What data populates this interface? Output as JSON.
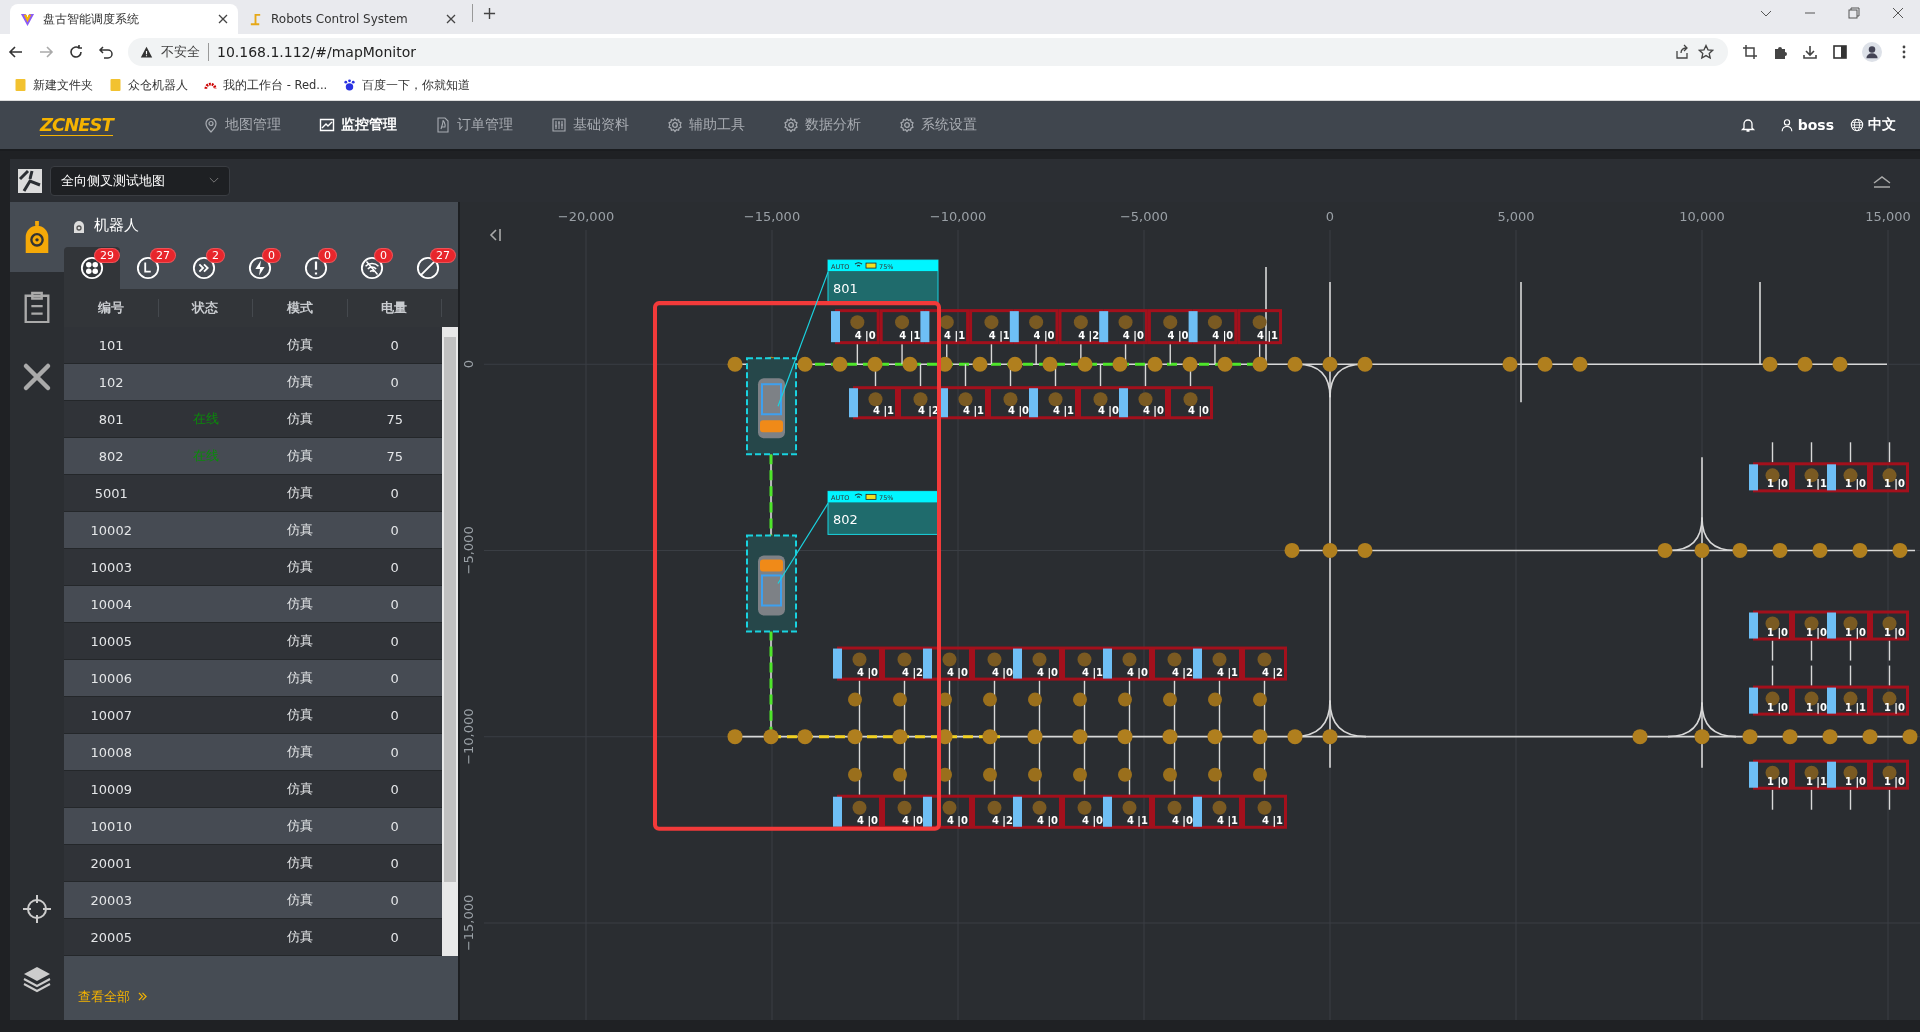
{
  "browser": {
    "tabs": [
      {
        "title": "盘古智能调度系统",
        "selected": true
      },
      {
        "title": "Robots Control System",
        "selected": false
      }
    ],
    "address": {
      "security": "不安全",
      "url": "10.168.1.112/#/mapMonitor"
    },
    "bookmarks": [
      "新建文件夹",
      "众仓机器人",
      "我的工作台 - Red...",
      "百度一下，你就知道"
    ]
  },
  "nav": {
    "logo": "ZCNEST",
    "items": [
      {
        "label": "地图管理",
        "selected": false
      },
      {
        "label": "监控管理",
        "selected": true
      },
      {
        "label": "订单管理",
        "selected": false
      },
      {
        "label": "基础资料",
        "selected": false
      },
      {
        "label": "辅助工具",
        "selected": false
      },
      {
        "label": "数据分析",
        "selected": false
      },
      {
        "label": "系统设置",
        "selected": false
      }
    ],
    "user": "boss",
    "language": "中文"
  },
  "map_selector": {
    "value": "全向侧叉测试地图"
  },
  "robot_panel": {
    "title": "机器人",
    "filters": [
      {
        "badge": "29",
        "selected": true
      },
      {
        "badge": "27",
        "selected": false
      },
      {
        "badge": "2",
        "selected": false
      },
      {
        "badge": "0",
        "selected": false
      },
      {
        "badge": "0",
        "selected": false
      },
      {
        "badge": "0",
        "selected": false
      },
      {
        "badge": "27",
        "selected": false
      }
    ],
    "columns": [
      "编号",
      "状态",
      "模式",
      "电量"
    ],
    "rows": [
      {
        "id": "101",
        "status": "",
        "mode": "仿真",
        "battery": "0"
      },
      {
        "id": "102",
        "status": "",
        "mode": "仿真",
        "battery": "0"
      },
      {
        "id": "801",
        "status": "在线",
        "mode": "仿真",
        "battery": "75"
      },
      {
        "id": "802",
        "status": "在线",
        "mode": "仿真",
        "battery": "75"
      },
      {
        "id": "5001",
        "status": "",
        "mode": "仿真",
        "battery": "0"
      },
      {
        "id": "10002",
        "status": "",
        "mode": "仿真",
        "battery": "0"
      },
      {
        "id": "10003",
        "status": "",
        "mode": "仿真",
        "battery": "0"
      },
      {
        "id": "10004",
        "status": "",
        "mode": "仿真",
        "battery": "0"
      },
      {
        "id": "10005",
        "status": "",
        "mode": "仿真",
        "battery": "0"
      },
      {
        "id": "10006",
        "status": "",
        "mode": "仿真",
        "battery": "0"
      },
      {
        "id": "10007",
        "status": "",
        "mode": "仿真",
        "battery": "0"
      },
      {
        "id": "10008",
        "status": "",
        "mode": "仿真",
        "battery": "0"
      },
      {
        "id": "10009",
        "status": "",
        "mode": "仿真",
        "battery": "0"
      },
      {
        "id": "10010",
        "status": "",
        "mode": "仿真",
        "battery": "0"
      },
      {
        "id": "20001",
        "status": "",
        "mode": "仿真",
        "battery": "0"
      },
      {
        "id": "20003",
        "status": "",
        "mode": "仿真",
        "battery": "0"
      },
      {
        "id": "20005",
        "status": "",
        "mode": "仿真",
        "battery": "0"
      }
    ],
    "view_all": "查看全部"
  },
  "map": {
    "x_ticks": [
      "−20,000",
      "−15,000",
      "−10,000",
      "−5,000",
      "0",
      "5,000",
      "10,000",
      "15,000"
    ],
    "y_ticks": [
      "0",
      "−5,000",
      "−10,000",
      "−15,000"
    ],
    "slot_rows": [
      {
        "labels": [
          "4 |0",
          "4 |1",
          "4 |1",
          "4 |1",
          "4 |0",
          "4 |2",
          "4 |0",
          "4 |0",
          "4 |0",
          "4 |1"
        ]
      },
      {
        "labels": [
          "4 |1",
          "4 |2",
          "4 |1",
          "4 |0",
          "4 |1",
          "4 |0",
          "4 |0",
          "4 |0"
        ]
      },
      {
        "labels": [
          "4 |0",
          "4 |2",
          "4 |0",
          "4 |0",
          "4 |0",
          "4 |1",
          "4 |0",
          "4 |2",
          "4 |1",
          "4 |2"
        ]
      },
      {
        "labels": [
          "4 |0",
          "4 |0",
          "4 |0",
          "4 |2",
          "4 |0",
          "4 |0",
          "4 |1",
          "4 |0",
          "4 |1",
          "4 |1"
        ]
      },
      {
        "labels": [
          "1 |0",
          "1 |1",
          "1 |0",
          "1 |0"
        ]
      },
      {
        "labels": [
          "1 |0",
          "1 |0",
          "1 |0",
          "1 |0"
        ]
      },
      {
        "labels": [
          "1 |0",
          "1 |0",
          "1 |1",
          "1 |0"
        ]
      },
      {
        "labels": [
          "1 |0",
          "1 |1",
          "1 |0",
          "1 |0"
        ]
      }
    ],
    "robots": [
      {
        "name": "801",
        "mode": "AUTO",
        "battery": "75%"
      },
      {
        "name": "802",
        "mode": "AUTO",
        "battery": "75%"
      }
    ]
  }
}
